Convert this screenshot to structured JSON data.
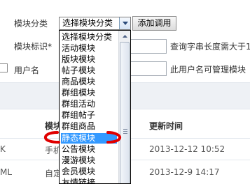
{
  "form": {
    "block_category_label": "模块分类",
    "block_category_selected": "选择模块分类",
    "add_button_label": "添加调用",
    "block_identifier_label": "模块标识*",
    "block_identifier_hint": "查询字串长度需大于1",
    "username_label": "用户名",
    "username_hint": "此用户名可管理模块"
  },
  "table": {
    "headers": {
      "col1_partial": "模块",
      "updated": "更新时间"
    },
    "rows": [
      {
        "left_fragment": "K",
        "name_fragment": "手机",
        "updated": "2013-12-12 10:52"
      },
      {
        "left_fragment": "ML",
        "name_fragment": "自定",
        "updated": "2013-12-9 14:17"
      }
    ]
  },
  "dropdown": {
    "items": [
      "选择模块分类",
      "活动模块",
      "版块模块",
      "帖子模块",
      "商品模块",
      "群组模块",
      "群组活动",
      "群组帖子",
      "群组商品",
      "静态模块",
      "公告模块",
      "漫游模块",
      "会员模块",
      "友情链接"
    ],
    "selected_index": 9
  },
  "annotation_color": "#e00000",
  "selection_color": "#3399ff"
}
